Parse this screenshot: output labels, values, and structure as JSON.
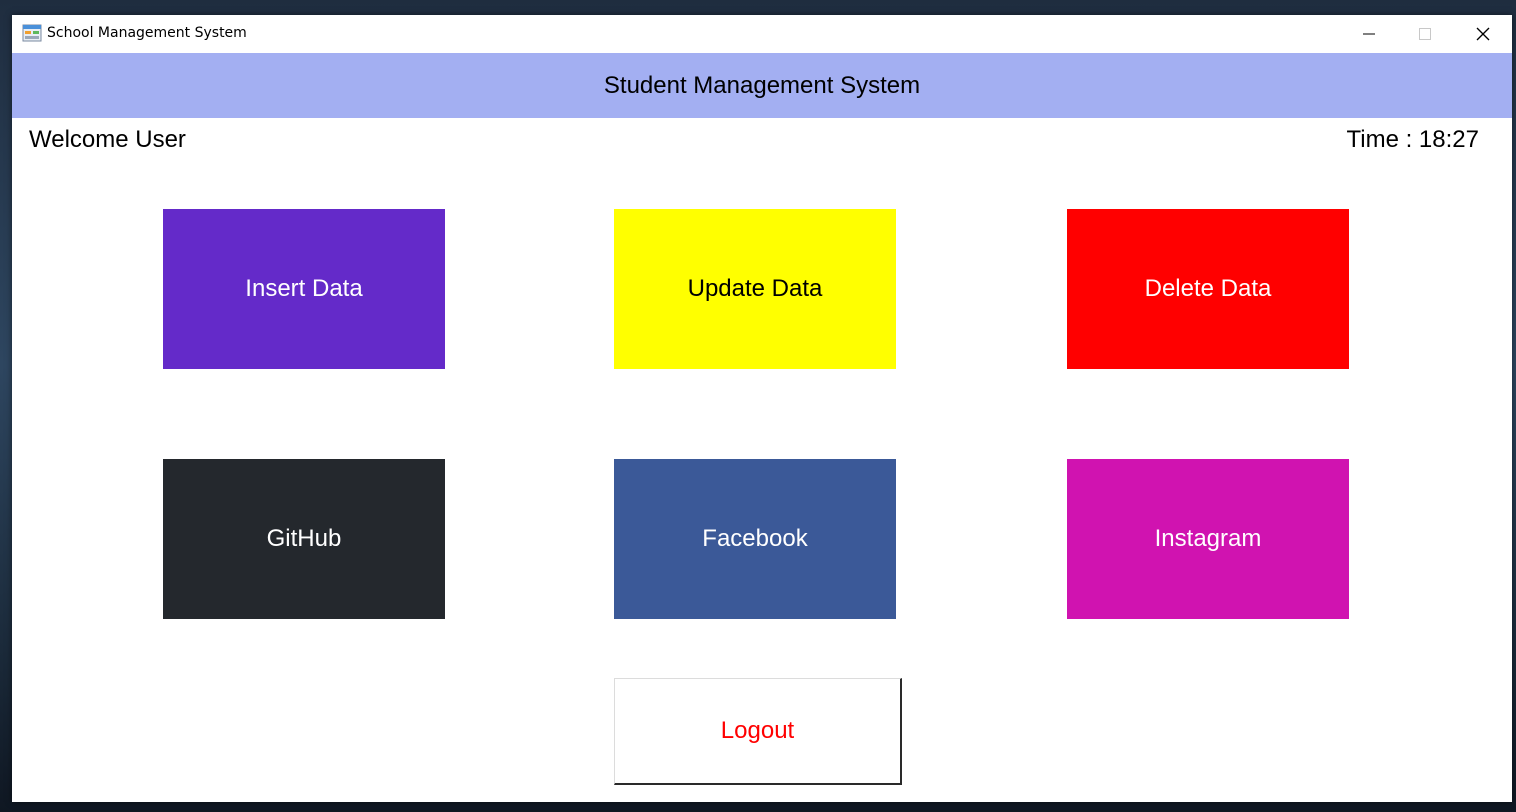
{
  "window": {
    "title": "School Management System"
  },
  "header": {
    "title": "Student Management System"
  },
  "info": {
    "welcome": "Welcome User",
    "time": "Time : 18:27"
  },
  "tiles": [
    {
      "label": "Insert Data",
      "bg": "#642ac9",
      "fg": "#ffffff"
    },
    {
      "label": "Update Data",
      "bg": "#ffff00",
      "fg": "#000000"
    },
    {
      "label": "Delete Data",
      "bg": "#ff0000",
      "fg": "#ffffff"
    },
    {
      "label": "GitHub",
      "bg": "#24282d",
      "fg": "#ffffff"
    },
    {
      "label": "Facebook",
      "bg": "#3b5998",
      "fg": "#ffffff"
    },
    {
      "label": "Instagram",
      "bg": "#d013b0",
      "fg": "#ffffff"
    }
  ],
  "logout": {
    "label": "Logout",
    "fg": "#ff0000"
  },
  "colors": {
    "header_bg": "#a3aff2"
  }
}
